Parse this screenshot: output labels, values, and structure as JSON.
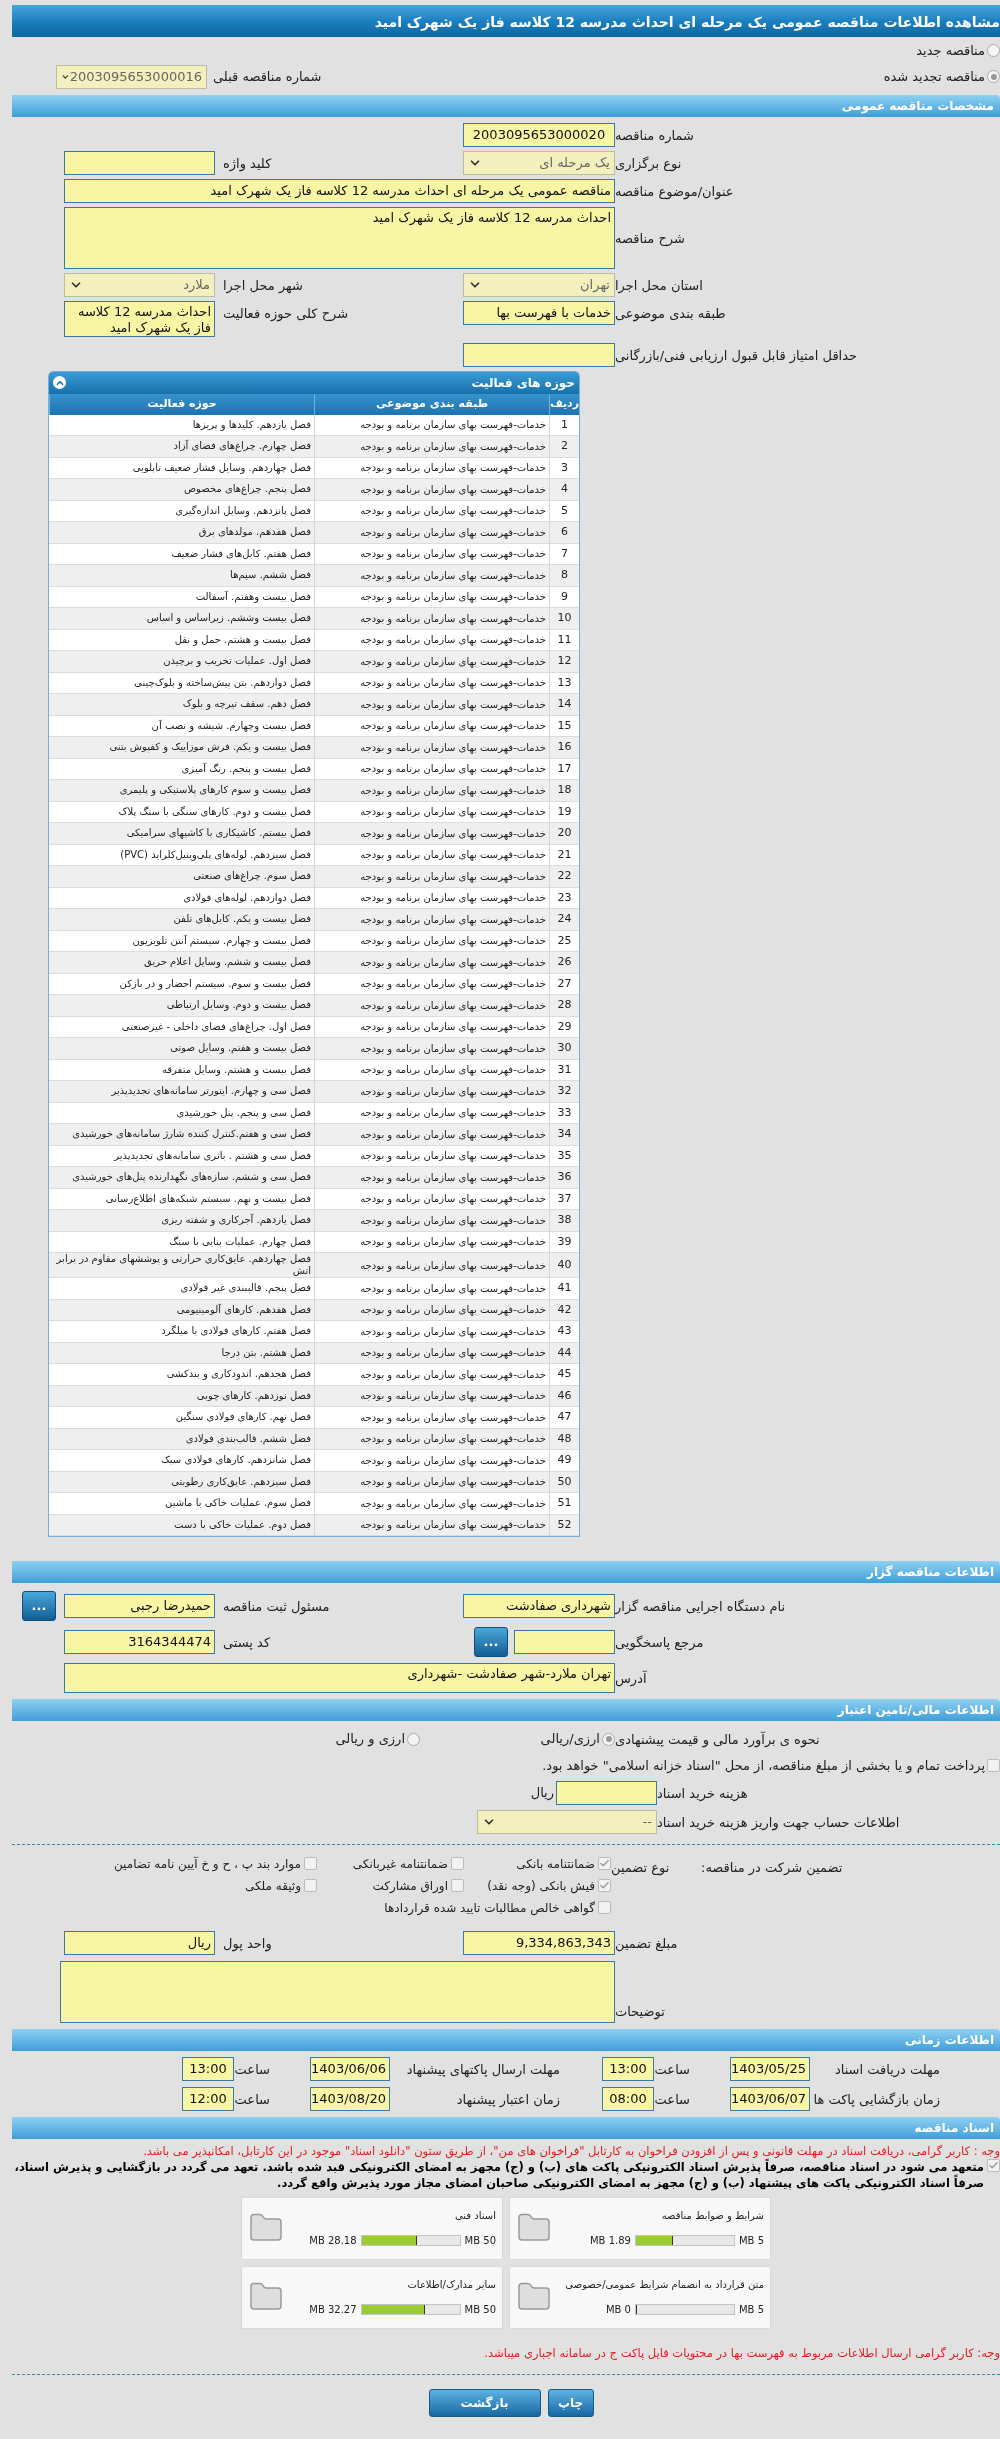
{
  "page_title": "مشاهده اطلاعات مناقصه عمومی یک مرحله ای احداث مدرسه 12 کلاسه فاز یک شهرک امید",
  "tender_type": [
    {
      "label": "مناقصه جدید",
      "selected": false
    },
    {
      "label": "مناقصه تجدید شده",
      "selected": true
    }
  ],
  "previous_tender": {
    "label": "شماره مناقصه قبلی",
    "value": "2003095653000016"
  },
  "general": {
    "title": "مشخصات مناقصه عمومی",
    "tender_number": {
      "label": "شماره مناقصه",
      "value": "2003095653000020"
    },
    "holding_type": {
      "label": "نوع برگزاری",
      "value": "یک مرحله ای"
    },
    "keyword": {
      "label": "کلید واژه"
    },
    "subject": {
      "label": "عنوان/موضوع مناقصه",
      "value": "مناقصه عمومی یک مرحله ای احداث مدرسه 12 کلاسه فاز یک شهرک امید"
    },
    "description": {
      "label": "شرح مناقصه",
      "value": "احداث مدرسه 12 کلاسه فاز یک شهرک امید"
    },
    "province": {
      "label": "استان محل اجرا",
      "value": "تهران"
    },
    "city": {
      "label": "شهر محل اجرا",
      "value": "ملارد"
    },
    "category": {
      "label": "طبقه بندی موضوعی",
      "value": "خدمات با فهرست بها"
    },
    "activity_summary": {
      "label": "شرح کلی حوزه فعالیت",
      "value": "احداث مدرسه 12 کلاسه فاز یک شهرک امید"
    },
    "min_score": {
      "label": "حداقل امتیاز قابل قبول ارزیابی فنی/بازرگانی"
    }
  },
  "activities": {
    "title": "حوزه های فعالیت",
    "columns": [
      "ردیف",
      "طبقه بندی موضوعی",
      "حوزه فعالیت"
    ],
    "rows": [
      {
        "row": "1",
        "category": "خدمات-فهرست بهای سازمان برنامه و بودجه",
        "activity": "فصل یازدهم. کلیدها و پریزها"
      },
      {
        "row": "2",
        "category": "خدمات-فهرست بهای سازمان برنامه و بودجه",
        "activity": "فصل چهارم. چراغ‌های فضای آزاد"
      },
      {
        "row": "3",
        "category": "خدمات-فهرست بهای سازمان برنامه و بودجه",
        "activity": "فصل چهاردهم. وسایل فشار ضعیف تابلویی"
      },
      {
        "row": "4",
        "category": "خدمات-فهرست بهای سازمان برنامه و بودجه",
        "activity": "فصل پنجم. چراغ‌های مخصوص"
      },
      {
        "row": "5",
        "category": "خدمات-فهرست بهای سازمان برنامه و بودجه",
        "activity": "فصل پانزدهم. وسایل اندازه‌گیری"
      },
      {
        "row": "6",
        "category": "خدمات-فهرست بهای سازمان برنامه و بودجه",
        "activity": "فصل هفدهم. مولدهای برق"
      },
      {
        "row": "7",
        "category": "خدمات-فهرست بهای سازمان برنامه و بودجه",
        "activity": "فصل هفتم. کابل‌های فشار ضعیف"
      },
      {
        "row": "8",
        "category": "خدمات-فهرست بهای سازمان برنامه و بودجه",
        "activity": "فصل ششم. سیم‌ها"
      },
      {
        "row": "9",
        "category": "خدمات-فهرست بهای سازمان برنامه و بودجه",
        "activity": "فصل بیست وهفتم. آسفالت"
      },
      {
        "row": "10",
        "category": "خدمات-فهرست بهای سازمان برنامه و بودجه",
        "activity": "فصل بیست وششم. زیراساس و اساس"
      },
      {
        "row": "11",
        "category": "خدمات-فهرست بهای سازمان برنامه و بودجه",
        "activity": "فصل بیست و هشتم. حمل و نقل"
      },
      {
        "row": "12",
        "category": "خدمات-فهرست بهای سازمان برنامه و بودجه",
        "activity": "فصل اول. عملیات تخریب و برچیدن"
      },
      {
        "row": "13",
        "category": "خدمات-فهرست بهای سازمان برنامه و بودجه",
        "activity": "فصل دوازدهم. بتن پیش‌ساخته و بلوک‌چینی"
      },
      {
        "row": "14",
        "category": "خدمات-فهرست بهای سازمان برنامه و بودجه",
        "activity": "فصل دهم. سقف تیرچه و بلوک"
      },
      {
        "row": "15",
        "category": "خدمات-فهرست بهای سازمان برنامه و بودجه",
        "activity": "فصل بیست وچهارم. شیشه و نصب آن"
      },
      {
        "row": "16",
        "category": "خدمات-فهرست بهای سازمان برنامه و بودجه",
        "activity": "فصل بیست و یکم. فرش موزاییک و کفپوش بتنی"
      },
      {
        "row": "17",
        "category": "خدمات-فهرست بهای سازمان برنامه و بودجه",
        "activity": "فصل بیست و پنجم. رنگ آمیزی"
      },
      {
        "row": "18",
        "category": "خدمات-فهرست بهای سازمان برنامه و بودجه",
        "activity": "فصل بیست و سوم کارهای پلاستیکی و پلیمری"
      },
      {
        "row": "19",
        "category": "خدمات-فهرست بهای سازمان برنامه و بودجه",
        "activity": "فصل بیست و دوم. کارهای سنگی با سنگ پلاک"
      },
      {
        "row": "20",
        "category": "خدمات-فهرست بهای سازمان برنامه و بودجه",
        "activity": "فصل بیستم. کاشیکاری با کاشیهای سرامیکی"
      },
      {
        "row": "21",
        "category": "خدمات-فهرست بهای سازمان برنامه و بودجه",
        "activity": "فصل سیزدهم. لوله‌های پلی‌وینیل‌کلراید (PVC)"
      },
      {
        "row": "22",
        "category": "خدمات-فهرست بهای سازمان برنامه و بودجه",
        "activity": "فصل سوم. چراغ‌های صنعتی"
      },
      {
        "row": "23",
        "category": "خدمات-فهرست بهای سازمان برنامه و بودجه",
        "activity": "فصل دوازدهم. لوله‌های فولادی"
      },
      {
        "row": "24",
        "category": "خدمات-فهرست بهای سازمان برنامه و بودجه",
        "activity": "فصل بیست و یکم. کابل‌های تلفن"
      },
      {
        "row": "25",
        "category": "خدمات-فهرست بهای سازمان برنامه و بودجه",
        "activity": "فصل بیست و چهارم. سیستم آنتن تلویزیون"
      },
      {
        "row": "26",
        "category": "خدمات-فهرست بهای سازمان برنامه و بودجه",
        "activity": "فصل بیست و ششم. وسایل اعلام حریق"
      },
      {
        "row": "27",
        "category": "خدمات-فهرست بهای سازمان برنامه و بودجه",
        "activity": "فصل بیست و سوم. سیستم احضار و در بازکن"
      },
      {
        "row": "28",
        "category": "خدمات-فهرست بهای سازمان برنامه و بودجه",
        "activity": "فصل بیست و دوم. وسایل ارتباطی"
      },
      {
        "row": "29",
        "category": "خدمات-فهرست بهای سازمان برنامه و بودجه",
        "activity": "فصل اول. چراغ‌های فضای داخلی - غیرصنعتی"
      },
      {
        "row": "30",
        "category": "خدمات-فهرست بهای سازمان برنامه و بودجه",
        "activity": "فصل بیست و هفتم. وسایل صوتی"
      },
      {
        "row": "31",
        "category": "خدمات-فهرست بهای سازمان برنامه و بودجه",
        "activity": "فصل بیست و هشتم. وسایل متفرقه"
      },
      {
        "row": "32",
        "category": "خدمات-فهرست بهای سازمان برنامه و بودجه",
        "activity": "فصل سی و چهارم. اینورتر سامانه‌های تجدیدپذیر"
      },
      {
        "row": "33",
        "category": "خدمات-فهرست بهای سازمان برنامه و بودجه",
        "activity": "فصل سی و پنجم. پنل خورشیدی"
      },
      {
        "row": "34",
        "category": "خدمات-فهرست بهای سازمان برنامه و بودجه",
        "activity": "فصل سی و هفتم.کنترل کننده شارژ سامانه‌های خورشیدی"
      },
      {
        "row": "35",
        "category": "خدمات-فهرست بهای سازمان برنامه و بودجه",
        "activity": "فصل سی و هشتم . باتری سامانه‌های تجدیدپذیر"
      },
      {
        "row": "36",
        "category": "خدمات-فهرست بهای سازمان برنامه و بودجه",
        "activity": "فصل سی و ششم. سازه‌های نگهدارنده پنل‌های خورشیدی"
      },
      {
        "row": "37",
        "category": "خدمات-فهرست بهای سازمان برنامه و بودجه",
        "activity": "فصل بیست و نهم. سیستم شبکه‌های اطلاع‌رسانی"
      },
      {
        "row": "38",
        "category": "خدمات-فهرست بهای سازمان برنامه و بودجه",
        "activity": "فصل یازدهم. آجرکاری و شفته ریزی"
      },
      {
        "row": "39",
        "category": "خدمات-فهرست بهای سازمان برنامه و بودجه",
        "activity": "فصل چهارم. عملیات بنایی با سنگ"
      },
      {
        "row": "40",
        "category": "خدمات-فهرست بهای سازمان برنامه و بودجه",
        "activity": "فصل چهاردهم. عایق‌کاری حرارتی و پوششهای مقاوم در برابر اتش"
      },
      {
        "row": "41",
        "category": "خدمات-فهرست بهای سازمان برنامه و بودجه",
        "activity": "فصل پنجم. قالببندی غیر فولادی"
      },
      {
        "row": "42",
        "category": "خدمات-فهرست بهای سازمان برنامه و بودجه",
        "activity": "فصل هفدهم. کارهای آلومینیومی"
      },
      {
        "row": "43",
        "category": "خدمات-فهرست بهای سازمان برنامه و بودجه",
        "activity": "فصل هفتم. کارهای فولادی با میلگرد"
      },
      {
        "row": "44",
        "category": "خدمات-فهرست بهای سازمان برنامه و بودجه",
        "activity": "فصل هشتم. بتن درجا"
      },
      {
        "row": "45",
        "category": "خدمات-فهرست بهای سازمان برنامه و بودجه",
        "activity": "فصل هجدهم. اندودکاری و بندکشی"
      },
      {
        "row": "46",
        "category": "خدمات-فهرست بهای سازمان برنامه و بودجه",
        "activity": "فصل نوزدهم. کارهای چوبی"
      },
      {
        "row": "47",
        "category": "خدمات-فهرست بهای سازمان برنامه و بودجه",
        "activity": "فصل نهم. کارهای فولادی سنگین"
      },
      {
        "row": "48",
        "category": "خدمات-فهرست بهای سازمان برنامه و بودجه",
        "activity": "فصل ششم. قالب‌بندی فولادی"
      },
      {
        "row": "49",
        "category": "خدمات-فهرست بهای سازمان برنامه و بودجه",
        "activity": "فصل شانزدهم. کارهای فولادی سبک"
      },
      {
        "row": "50",
        "category": "خدمات-فهرست بهای سازمان برنامه و بودجه",
        "activity": "فصل سیزدهم. عایق‌کاری رطوبتی"
      },
      {
        "row": "51",
        "category": "خدمات-فهرست بهای سازمان برنامه و بودجه",
        "activity": "فصل سوم. عملیات خاکی با ماشین"
      },
      {
        "row": "52",
        "category": "خدمات-فهرست بهای سازمان برنامه و بودجه",
        "activity": "فصل دوم. عملیات خاکی با دست"
      }
    ]
  },
  "organizer": {
    "title": "اطلاعات مناقصه گزار",
    "org_name": {
      "label": "نام دستگاه اجرایی مناقصه گزار",
      "value": "شهرداری صفادشت"
    },
    "registrar": {
      "label": "مسئول ثبت مناقصه",
      "value": "حمیدرضا رجبی",
      "button": "..."
    },
    "responder": {
      "label": "مرجع پاسخگویی",
      "button": "..."
    },
    "postal_code": {
      "label": "کد پستی",
      "value": "3164344474"
    },
    "address": {
      "label": "آدرس",
      "value": "تهران ملارد-شهر صفادشت -شهرداری"
    }
  },
  "finance": {
    "title": "اطلاعات مالی/تامین اعتبار",
    "estimate": {
      "label": "نحوه ی برآورد مالی و قیمت پیشنهادی",
      "options": [
        {
          "label": "ارزی/ریالی",
          "selected": true
        },
        {
          "label": "ارزی و ریالی",
          "selected": false
        }
      ]
    },
    "treasury": {
      "label": "پرداخت تمام و یا بخشی از مبلغ مناقصه، از محل \"اسناد خزانه اسلامی\" خواهد بود.",
      "checked": false
    },
    "doc_fee": {
      "label": "هزینه خرید اسناد",
      "unit": "ریال"
    },
    "account": {
      "label": "اطلاعات حساب جهت واریز هزینه خرید اسناد",
      "value": "--"
    },
    "guarantee": {
      "label": "تضمین شرکت در مناقصه:",
      "type_label": "نوع تضمین",
      "options": [
        {
          "label": "ضمانتنامه بانکی",
          "checked": true
        },
        {
          "label": "ضمانتنامه غیربانکی",
          "checked": false
        },
        {
          "label": "موارد بند پ ، ح و خ آیین نامه تضامین",
          "checked": false
        },
        {
          "label": "فیش بانکی (وجه نقد)",
          "checked": true
        },
        {
          "label": "اوراق مشارکت",
          "checked": false
        },
        {
          "label": "وثیقه ملکی",
          "checked": false
        },
        {
          "label": "گواهی خالص مطالبات تایید شده قراردادها",
          "checked": false
        }
      ]
    },
    "amount": {
      "label": "مبلغ تضمین",
      "value": "9,334,863,343"
    },
    "currency": {
      "label": "واحد پول",
      "value": "ریال"
    },
    "notes": {
      "label": "توضیحات"
    }
  },
  "timing": {
    "title": "اطلاعات زمانی",
    "items": [
      {
        "label": "مهلت دریافت اسناد",
        "date": "1403/05/25",
        "time_label": "ساعت",
        "time": "13:00"
      },
      {
        "label": "مهلت ارسال پاکتهای پیشنهاد",
        "date": "1403/06/06",
        "time_label": "ساعت",
        "time": "13:00"
      },
      {
        "label": "زمان بازگشایی پاکت ها",
        "date": "1403/06/07",
        "time_label": "ساعت",
        "time": "08:00"
      },
      {
        "label": "زمان اعتبار پیشنهاد",
        "date": "1403/08/20",
        "time_label": "ساعت",
        "time": "12:00"
      }
    ]
  },
  "documents": {
    "title": "اسناد مناقصه",
    "notice": "وجه : کاربر گرامی، دریافت اسناد در مهلت قانونی و پس از افزودن فراخوان به کارتابل \"فراخوان های من\"، از طریق ستون \"دانلود اسناد\" موجود در این کارتابل، امکانپذیر می باشد.",
    "commitment": {
      "checked": true,
      "text": "متعهد می شود در اسناد مناقصه، صرفاً پذیرش اسناد الکترونیکی پاکت های (ب) و (ج) مجهز به امضای الکترونیکی قبد شده باشد. تعهد می گردد در بازگشایی و پذیرش اسناد، صرفاً اسناد الکترونیکی پاکت های پیشنهاد (ب) و (ج) مجهز به امضای الکترونیکی صاحبان امضای مجاز مورد پذیرش واقع گردد."
    },
    "files": [
      {
        "name": "شرایط و ضوابط مناقصه",
        "limit": "5 MB",
        "used": "1.89 MB",
        "level": 0.378
      },
      {
        "name": "اسناد فنی",
        "limit": "50 MB",
        "used": "28.18 MB",
        "level": 0.564
      },
      {
        "name": "متن قرارداد به انضمام شرایط عمومی/خصوصی",
        "limit": "5 MB",
        "used": "0 MB",
        "level": 0
      },
      {
        "name": "سایر مدارک/اطلاعات",
        "limit": "50 MB",
        "used": "32.27 MB",
        "level": 0.645
      }
    ],
    "bottom_notice": "وجه: کاربر گرامی ارسال اطلاعات مربوط به فهرست بها در محتویات فایل پاکت ج در سامانه اجباری میباشد."
  },
  "buttons": [
    "چاپ",
    "بازگشت"
  ]
}
